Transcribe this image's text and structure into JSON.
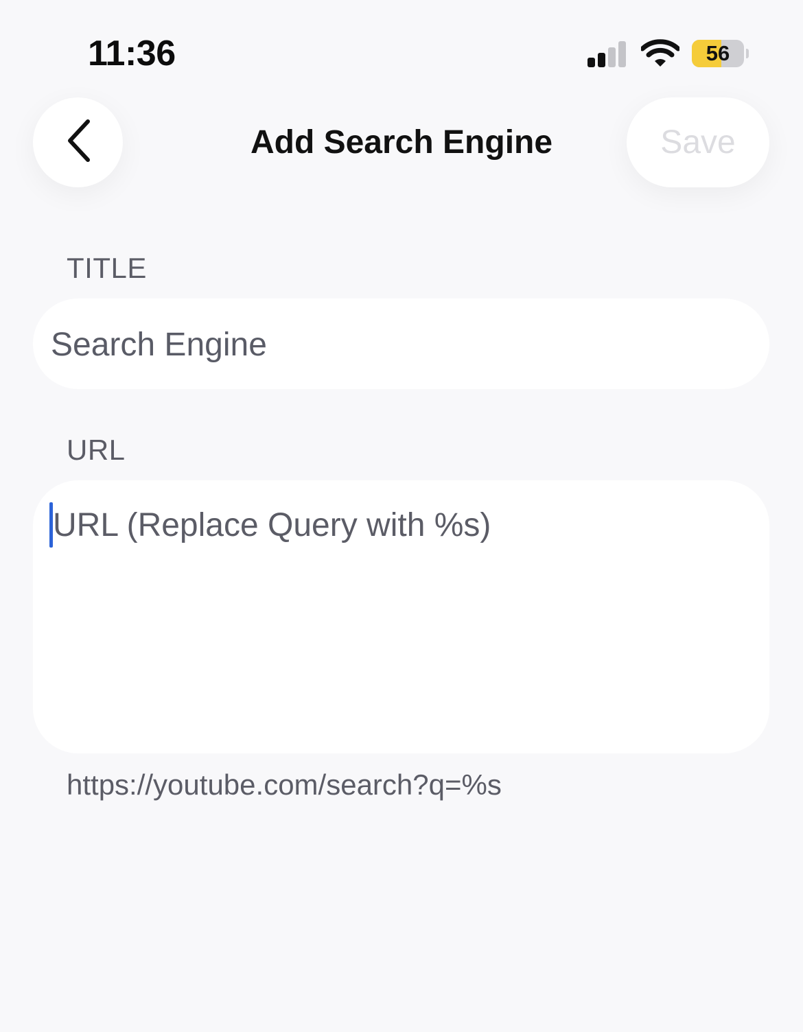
{
  "status_bar": {
    "time": "11:36",
    "battery_level": "56",
    "battery_fraction": 0.56,
    "signal_bars_active": 2,
    "signal_bars_total": 4
  },
  "nav": {
    "back_icon": "chevron-left-icon",
    "title": "Add Search Engine",
    "save_label": "Save"
  },
  "form": {
    "title_label": "TITLE",
    "title_value": "Search Engine",
    "url_label": "URL",
    "url_placeholder": "URL (Replace Query with %s)",
    "url_value": "",
    "hint": "https://youtube.com/search?q=%s"
  },
  "colors": {
    "background": "#f8f8fa",
    "caret": "#2c63d8",
    "battery": "#f5cc3a",
    "save_disabled": "#dcdce0"
  }
}
